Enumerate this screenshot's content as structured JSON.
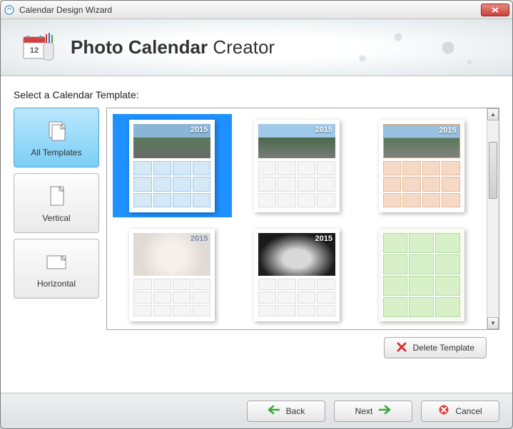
{
  "window": {
    "title": "Calendar Design Wizard"
  },
  "header": {
    "title_bold": "Photo Calendar",
    "title_light": " Creator"
  },
  "section_label": "Select a Calendar Template:",
  "categories": [
    {
      "label": "All Templates",
      "selected": true
    },
    {
      "label": "Vertical",
      "selected": false
    },
    {
      "label": "Horizontal",
      "selected": false
    }
  ],
  "templates": [
    {
      "year": "2015",
      "selected": true,
      "variant": "blue",
      "photo": "mountain"
    },
    {
      "year": "2015",
      "selected": false,
      "variant": "plain",
      "photo": "mountain-b"
    },
    {
      "year": "2015",
      "selected": false,
      "variant": "orange",
      "photo": "mountain-o"
    },
    {
      "year": "2015",
      "selected": false,
      "variant": "tall",
      "photo": "kitten"
    },
    {
      "year": "2015",
      "selected": false,
      "variant": "tall",
      "photo": "car"
    },
    {
      "year": "",
      "selected": false,
      "variant": "green-grid",
      "photo": "none"
    }
  ],
  "buttons": {
    "delete": "Delete Template",
    "back": "Back",
    "next": "Next",
    "cancel": "Cancel"
  }
}
